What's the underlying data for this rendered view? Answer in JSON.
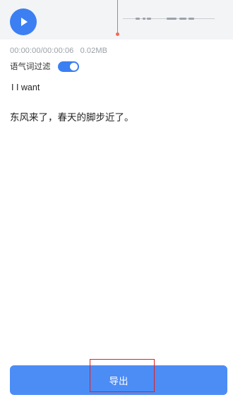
{
  "player": {
    "play_icon": "play-icon",
    "accent_color": "#3b7ff2",
    "playhead_color": "#f06a5a"
  },
  "meta": {
    "time": "00:00:00/00:00:06",
    "size": "0.02MB"
  },
  "filter": {
    "label": "语气词过滤",
    "enabled": true
  },
  "transcript": {
    "line1": "I I want",
    "line2": "东风来了，春天的脚步近了。"
  },
  "actions": {
    "export_label": "导出"
  }
}
